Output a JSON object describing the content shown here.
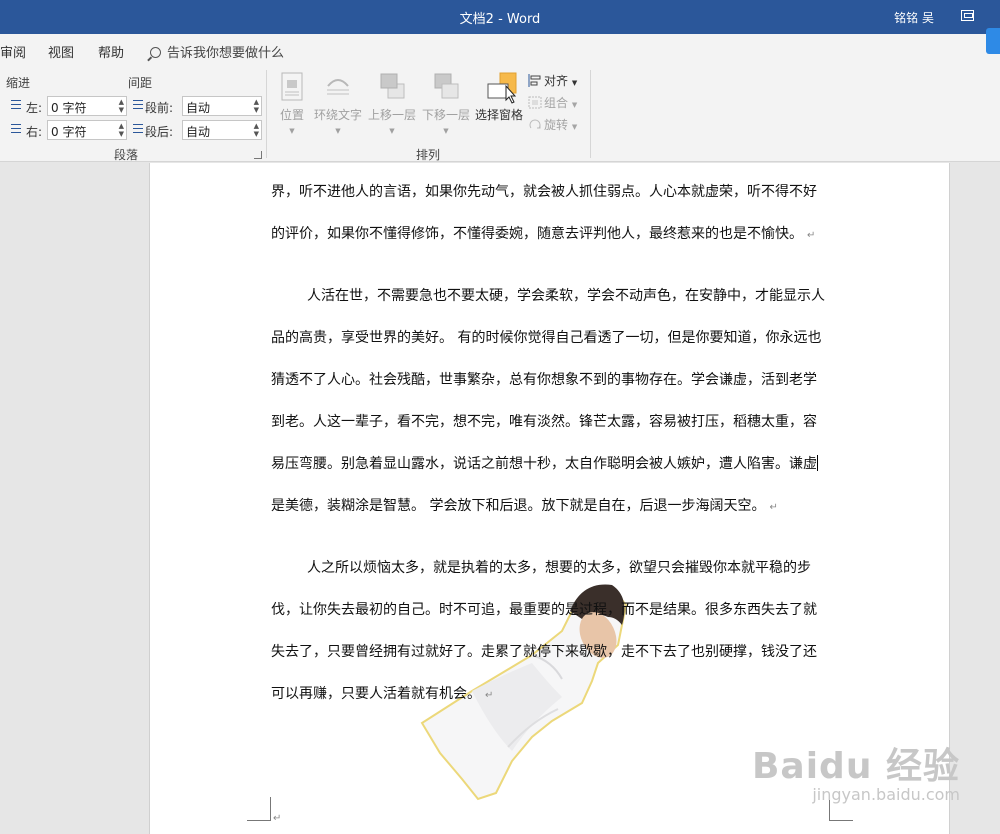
{
  "titlebar": {
    "title": "文档2  -  Word",
    "user": "铭铭 吴"
  },
  "tabs": [
    "审阅",
    "视图",
    "帮助"
  ],
  "tell_me": "告诉我你想要做什么",
  "ribbon": {
    "indent_label": "缩进",
    "spacing_label": "间距",
    "left_label": "左:",
    "left_value": "0 字符",
    "right_label": "右:",
    "right_value": "0 字符",
    "before_label": "段前:",
    "before_value": "自动",
    "after_label": "段后:",
    "after_value": "自动",
    "paragraph_group": "段落",
    "arrange_group": "排列",
    "position": "位置",
    "wrap_text": "环绕文字",
    "bring_forward": "上移一层",
    "send_backward": "下移一层",
    "selection_pane": "选择窗格",
    "align": "对齐",
    "group": "组合",
    "rotate": "旋转"
  },
  "document": {
    "p1": [
      "界，听不进他人的言语，如果你先动气，就会被人抓住弱点。人心本就虚荣，听不得不好",
      "的评价，如果你不懂得修饰，不懂得委婉，随意去评判他人，最终惹来的也是不愉快。"
    ],
    "p2": [
      "人活在世，不需要急也不要太硬，学会柔软，学会不动声色，在安静中，才能显示人",
      "品的高贵，享受世界的美好。 有的时候你觉得自己看透了一切，但是你要知道，你永远也",
      "猜透不了人心。社会残酷，世事繁杂，总有你想象不到的事物存在。学会谦虚，活到老学",
      "到老。人这一辈子，看不完，想不完，唯有淡然。锋芒太露，容易被打压，稻穗太重，容",
      "易压弯腰。别急着显山露水，说话之前想十秒，太自作聪明会被人嫉妒，遭人陷害。谦虚",
      "是美德，装糊涂是智慧。 学会放下和后退。放下就是自在，后退一步海阔天空。"
    ],
    "p3": [
      "人之所以烦恼太多，就是执着的太多，想要的太多，欲望只会摧毁你本就平稳的步",
      "伐，让你失去最初的自己。时不可追，最重要的是过程，而不是结果。很多东西失去了就",
      "失去了，只要曾经拥有过就好了。走累了就停下来歇歇，走不下去了也别硬撑，钱没了还",
      "可以再赚，只要人活着就有机会。"
    ]
  },
  "watermark": {
    "brand": "Baidu 经验",
    "url": "jingyan.baidu.com"
  }
}
